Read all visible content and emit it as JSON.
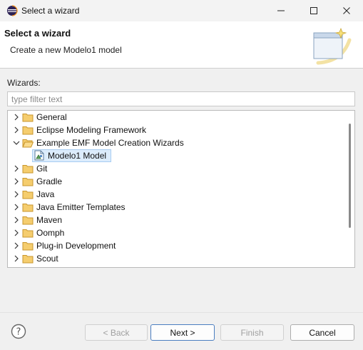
{
  "window": {
    "title": "Select a wizard",
    "controls": [
      "minimize-icon",
      "maximize-icon",
      "close-icon"
    ]
  },
  "header": {
    "title": "Select a wizard",
    "description": "Create a new Modelo1 model"
  },
  "wizards_label": "Wizards:",
  "filter": {
    "placeholder": "type filter text",
    "value": ""
  },
  "tree": {
    "items": [
      {
        "label": "General",
        "expanded": false,
        "level": 0,
        "icon": "folder-icon"
      },
      {
        "label": "Eclipse Modeling Framework",
        "expanded": false,
        "level": 0,
        "icon": "folder-icon"
      },
      {
        "label": "Example EMF Model Creation Wizards",
        "expanded": true,
        "level": 0,
        "icon": "folder-open-icon"
      },
      {
        "label": "Modelo1 Model",
        "level": 1,
        "icon": "model-file-icon",
        "selected": true
      },
      {
        "label": "Git",
        "expanded": false,
        "level": 0,
        "icon": "folder-icon"
      },
      {
        "label": "Gradle",
        "expanded": false,
        "level": 0,
        "icon": "folder-icon"
      },
      {
        "label": "Java",
        "expanded": false,
        "level": 0,
        "icon": "folder-icon"
      },
      {
        "label": "Java Emitter Templates",
        "expanded": false,
        "level": 0,
        "icon": "folder-icon"
      },
      {
        "label": "Maven",
        "expanded": false,
        "level": 0,
        "icon": "folder-icon"
      },
      {
        "label": "Oomph",
        "expanded": false,
        "level": 0,
        "icon": "folder-icon"
      },
      {
        "label": "Plug-in Development",
        "expanded": false,
        "level": 0,
        "icon": "folder-icon"
      },
      {
        "label": "Scout",
        "expanded": false,
        "level": 0,
        "icon": "folder-icon"
      }
    ]
  },
  "buttons": {
    "back": "< Back",
    "next": "Next >",
    "finish": "Finish",
    "cancel": "Cancel"
  },
  "colors": {
    "selection_bg": "#dcecfc",
    "folder": "#e8b84a",
    "default_button_border": "#4b7ec0"
  }
}
